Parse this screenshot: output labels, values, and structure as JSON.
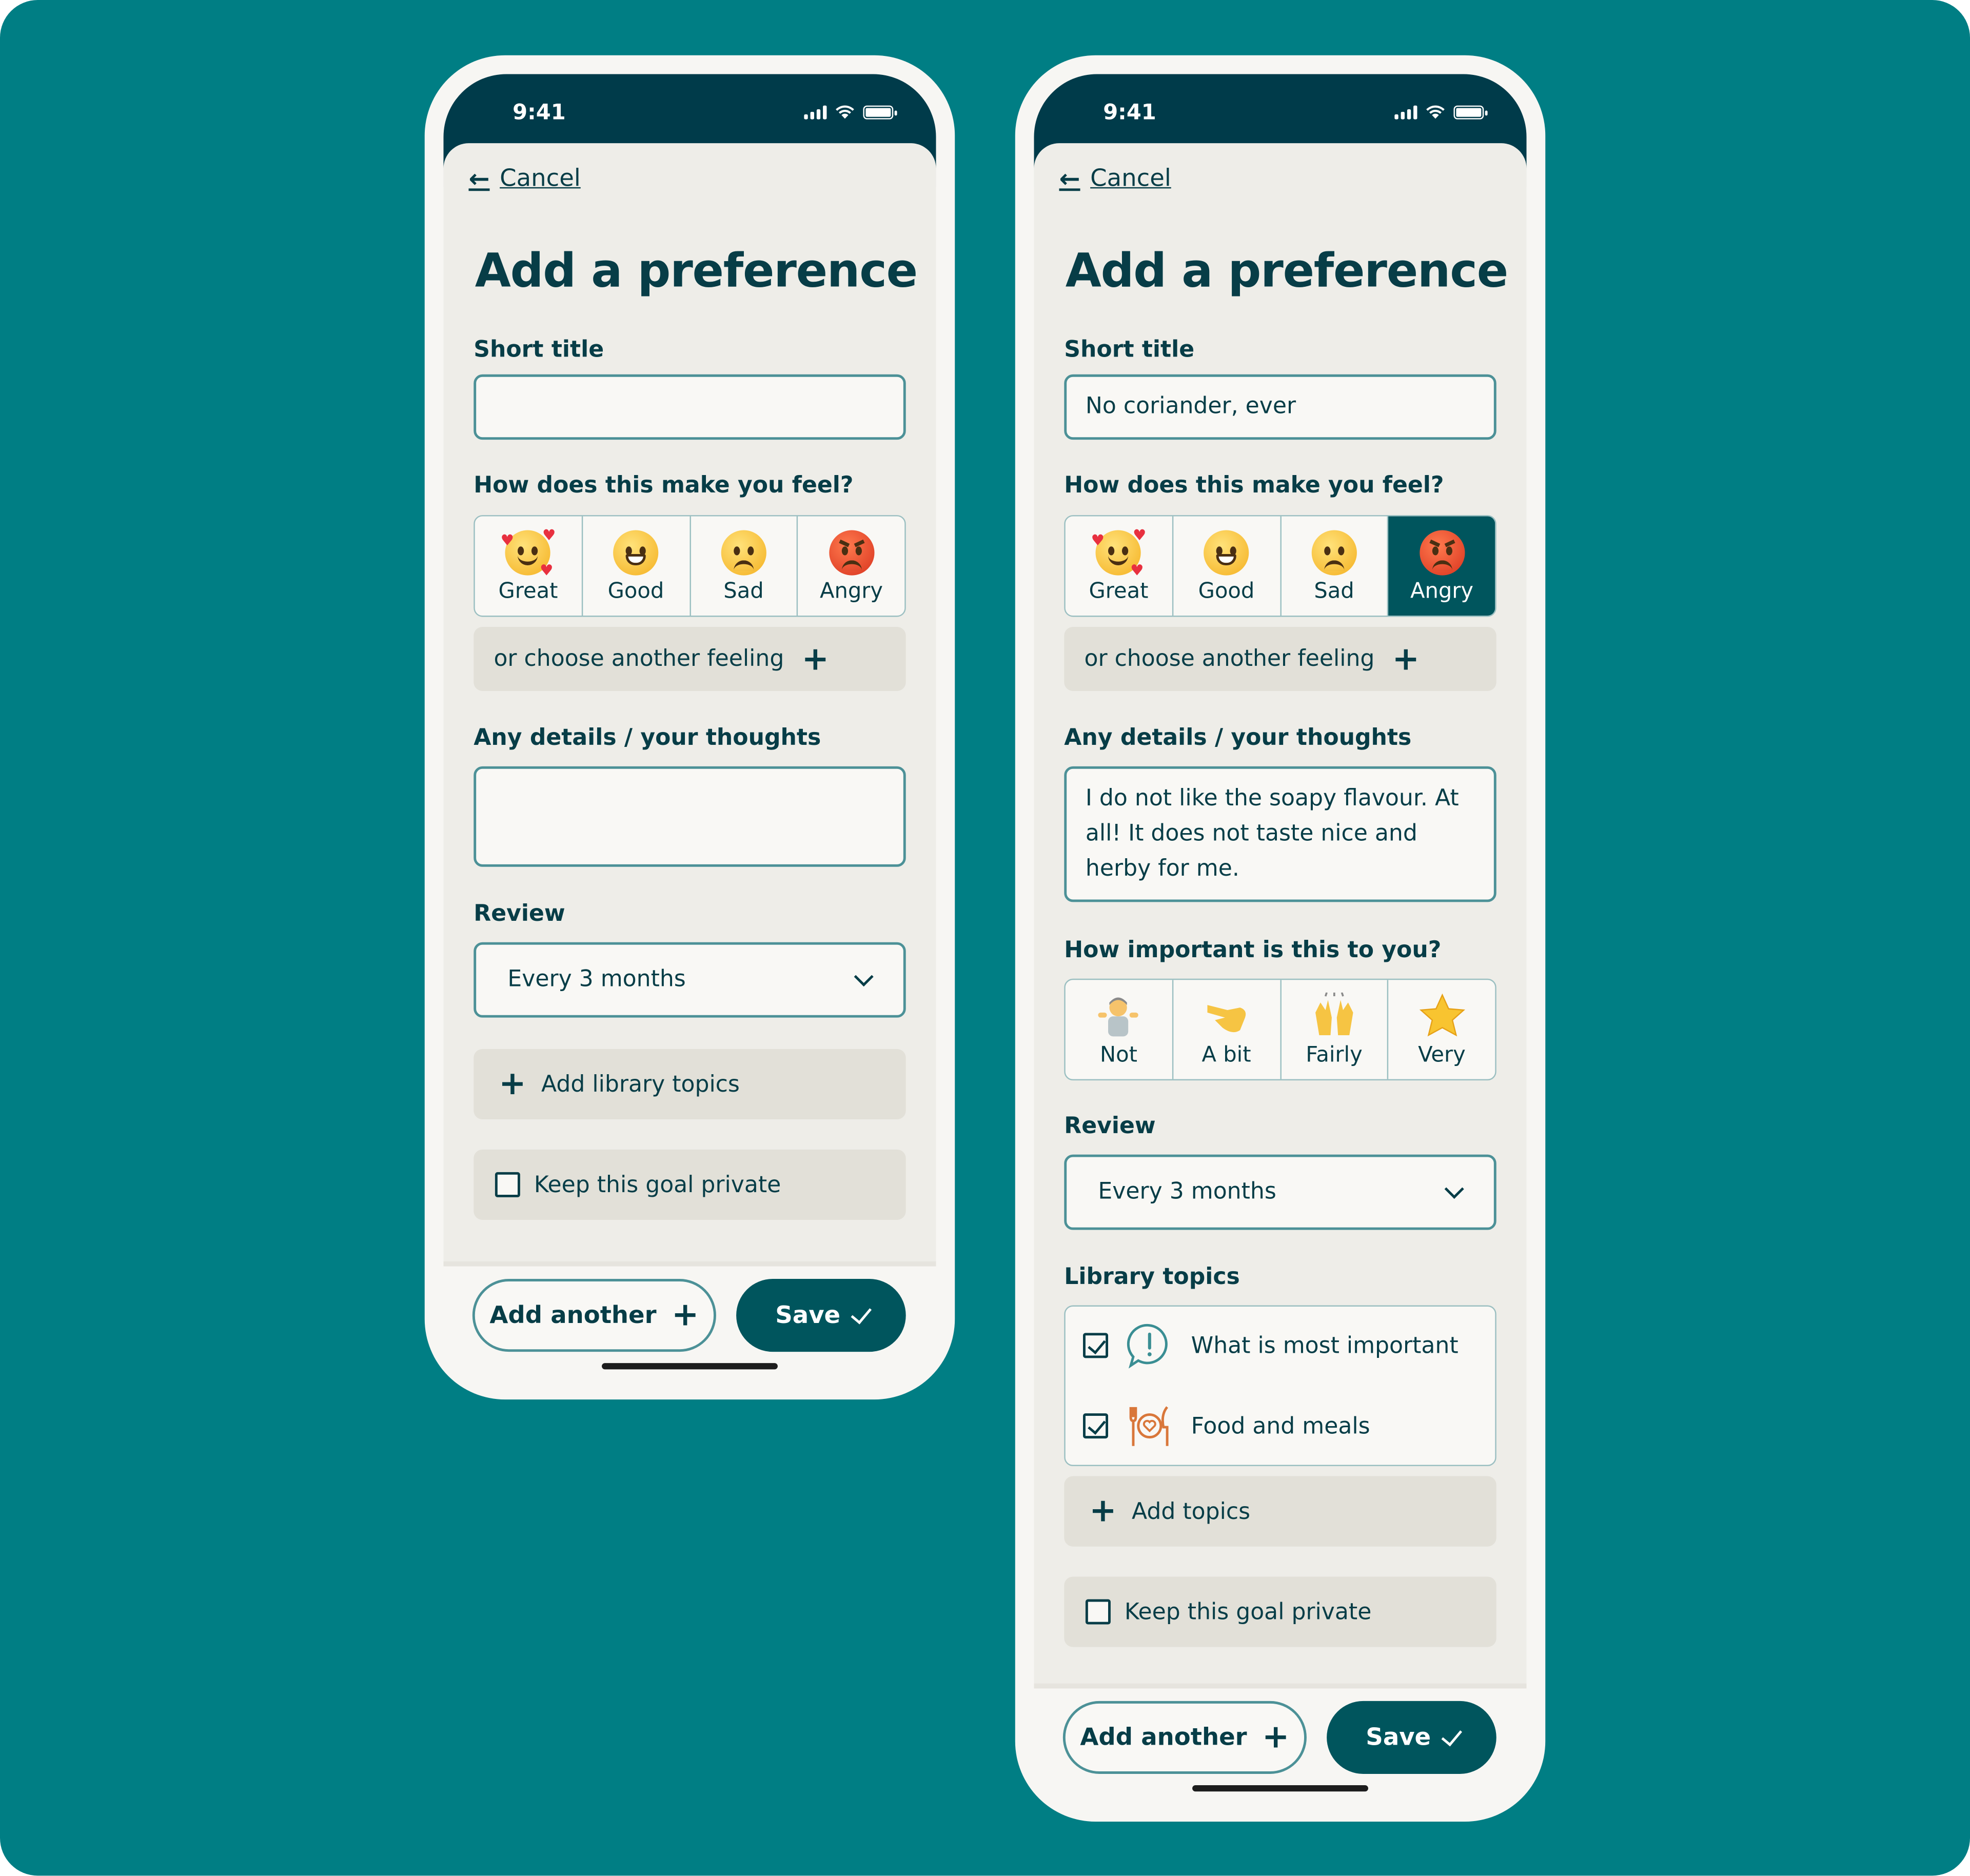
{
  "colors": {
    "background": "#007e84",
    "primary": "#00555d",
    "text": "#073d47",
    "status_bar": "#003b4a"
  },
  "screens": [
    {
      "status": {
        "time": "9:41"
      },
      "cancel": "Cancel",
      "title": "Add a preference",
      "short_title": {
        "label": "Short title",
        "value": ""
      },
      "feeling": {
        "label": "How does this make you feel?",
        "options": [
          "Great",
          "Good",
          "Sad",
          "Angry"
        ],
        "selected": null,
        "another": "or choose another feeling"
      },
      "details": {
        "label": "Any details / your thoughts",
        "value": ""
      },
      "review": {
        "label": "Review",
        "value": "Every 3 months"
      },
      "add_library": "Add library topics",
      "private": {
        "label": "Keep this goal private",
        "checked": false
      },
      "add_another": "Add another",
      "save": "Save"
    },
    {
      "status": {
        "time": "9:41"
      },
      "cancel": "Cancel",
      "title": "Add a preference",
      "short_title": {
        "label": "Short title",
        "value": "No coriander, ever"
      },
      "feeling": {
        "label": "How does this make you feel?",
        "options": [
          "Great",
          "Good",
          "Sad",
          "Angry"
        ],
        "selected": "Angry",
        "another": "or choose another feeling"
      },
      "details": {
        "label": "Any details / your thoughts",
        "value": "I do not like the soapy flavour. At all! It does not taste nice and herby for me."
      },
      "importance": {
        "label": "How important is this to you?",
        "options": [
          "Not",
          "A bit",
          "Fairly",
          "Very"
        ]
      },
      "review": {
        "label": "Review",
        "value": "Every 3 months"
      },
      "library": {
        "label": "Library topics",
        "topics": [
          {
            "label": "What is most important",
            "checked": true,
            "icon": "speech-bubble-exclamation-icon"
          },
          {
            "label": "Food and meals",
            "checked": true,
            "icon": "plate-cutlery-heart-icon"
          }
        ],
        "add": "Add topics"
      },
      "private": {
        "label": "Keep this goal private",
        "checked": false
      },
      "add_another": "Add another",
      "save": "Save"
    }
  ]
}
